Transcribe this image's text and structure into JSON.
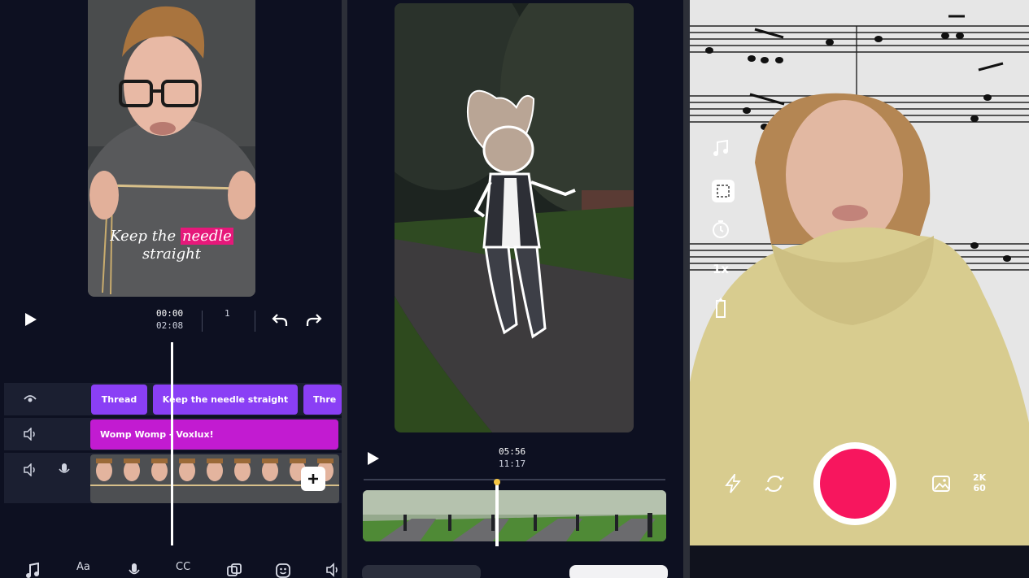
{
  "panel_left": {
    "caption_before": "Keep the",
    "caption_highlight": "needle",
    "caption_after": "straight",
    "time_current": "00:00",
    "time_total": "02:08",
    "frame_counter": "1",
    "tracks": {
      "text_clips": [
        "Thread",
        "Keep the needle straight",
        "Thre"
      ],
      "audio_clip": "Womp Womp - Voxlux!"
    },
    "toolbar": [
      "Aa",
      "CC"
    ],
    "colors": {
      "text_clip": "#8a3ff5",
      "audio_clip": "#c21bd1",
      "highlight": "#e6187a"
    }
  },
  "panel_middle": {
    "time_current": "05:56",
    "time_total": "11:17",
    "bottom_buttons": [
      "",
      ""
    ]
  },
  "panel_right": {
    "resolution": "2K",
    "fps": "60",
    "colors": {
      "record": "#f7165e"
    }
  }
}
